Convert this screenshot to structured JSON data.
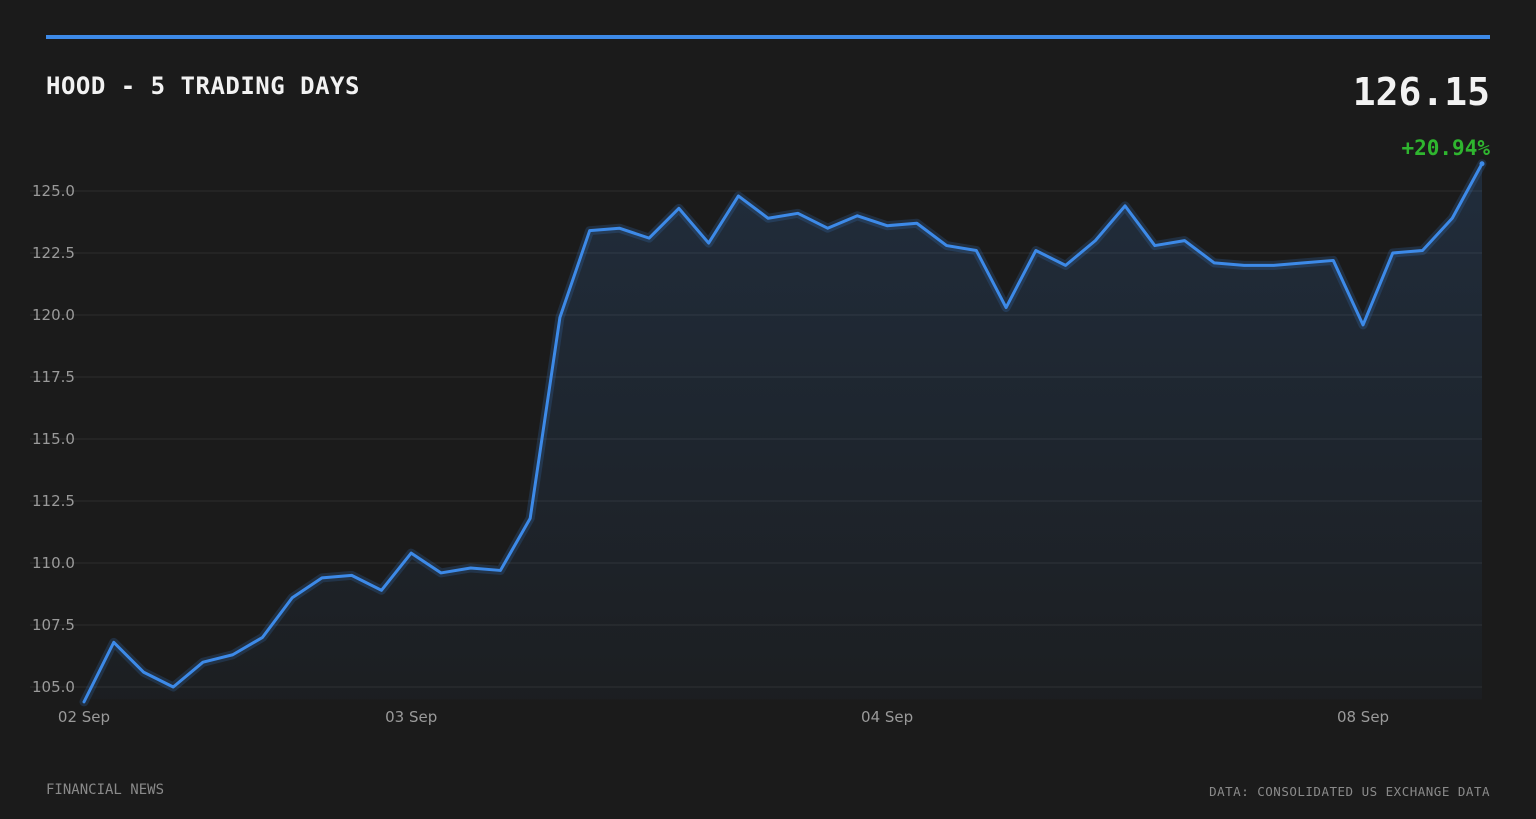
{
  "header": {
    "title": "HOOD - 5 TRADING DAYS",
    "price": "126.15",
    "change": "+20.94%"
  },
  "footer": {
    "source_left": "FINANCIAL NEWS",
    "source_right": "DATA: CONSOLIDATED US EXCHANGE DATA"
  },
  "colors": {
    "background": "#1b1b1b",
    "accent": "#3d8ae8",
    "positive": "#2fb52f",
    "grid": "#2e2e2e",
    "text_muted": "#9a9a9a"
  },
  "chart_data": {
    "type": "area",
    "title": "HOOD - 5 TRADING DAYS",
    "xlabel": "",
    "ylabel": "",
    "ylim": [
      104.5,
      126.2
    ],
    "yticks": [
      "105.0",
      "107.5",
      "110.0",
      "112.5",
      "115.0",
      "117.5",
      "120.0",
      "122.5",
      "125.0"
    ],
    "ytick_values": [
      105,
      107.5,
      110,
      112.5,
      115,
      117.5,
      120,
      122.5,
      125
    ],
    "xticks": [
      {
        "label": "02 Sep",
        "index": 0
      },
      {
        "label": "03 Sep",
        "index": 11
      },
      {
        "label": "04 Sep",
        "index": 27
      },
      {
        "label": "08 Sep",
        "index": 43
      }
    ],
    "grid": true,
    "series": [
      {
        "values": [
          104.4,
          106.8,
          105.6,
          105.0,
          106.0,
          106.3,
          107.0,
          108.6,
          109.4,
          109.5,
          108.9,
          110.4,
          109.6,
          109.8,
          109.7,
          111.8,
          119.9,
          123.4,
          123.5,
          123.1,
          124.3,
          122.9,
          124.8,
          123.9,
          124.1,
          123.5,
          124.0,
          123.6,
          123.7,
          122.8,
          122.6,
          120.3,
          122.6,
          122.0,
          123.0,
          124.4,
          122.8,
          123.0,
          122.1,
          122.0,
          122.0,
          122.1,
          122.2,
          119.6,
          122.5,
          122.6,
          123.9,
          126.1
        ]
      }
    ]
  }
}
